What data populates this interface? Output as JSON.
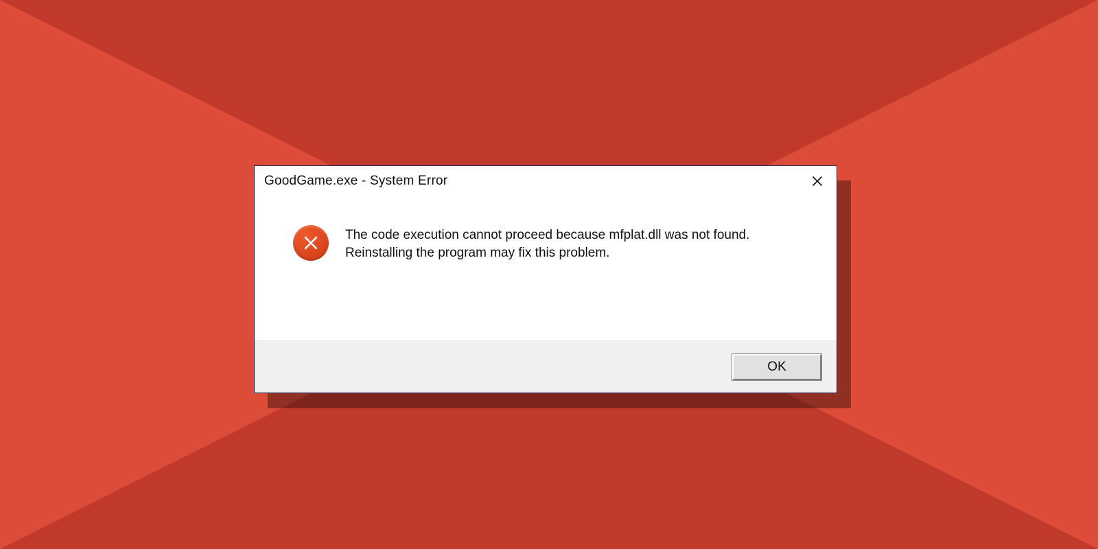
{
  "dialog": {
    "title": "GoodGame.exe - System Error",
    "close_label": "Close",
    "message": "The code execution cannot proceed because mfplat.dll was not found. Reinstalling the program may fix this problem.",
    "ok_label": "OK",
    "icons": {
      "error": "error-icon",
      "close": "close-icon"
    }
  },
  "colors": {
    "bg_base": "#dd4b39",
    "bg_dark": "#c0392b",
    "dialog_border": "#1a2b5c",
    "footer_bg": "#f0f0f0",
    "error_icon": "#e04a1f"
  }
}
